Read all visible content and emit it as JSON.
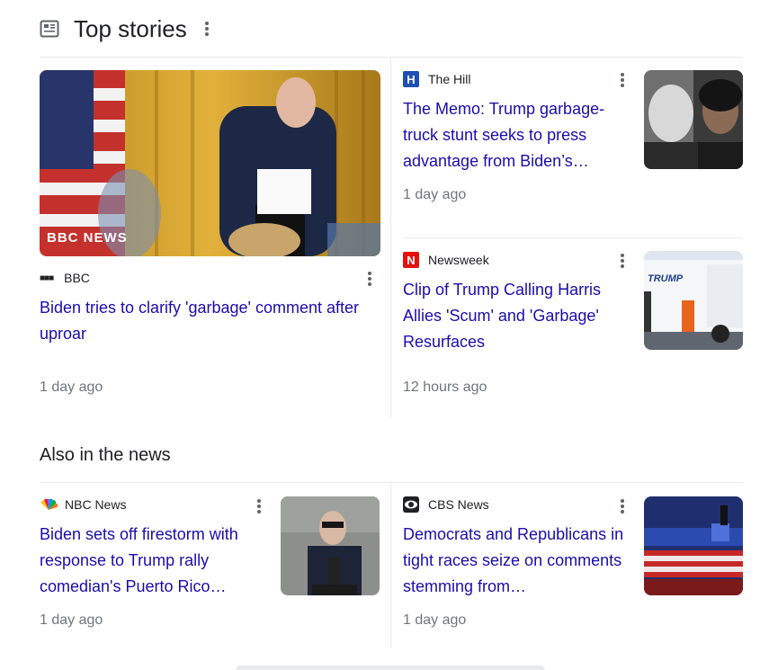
{
  "top_stories": {
    "title": "Top stories",
    "cards": [
      {
        "source": "BBC",
        "headline": "Biden tries to clarify 'garbage' comment after uproar",
        "time": "1 day ago",
        "image_label": "BBC NEWS"
      },
      {
        "source": "The Hill",
        "headline": "The Memo: Trump garbage-truck stunt seeks to press advantage from Biden’s…",
        "time": "1 day ago"
      },
      {
        "source": "Newsweek",
        "headline": "Clip of Trump Calling Harris Allies 'Scum' and 'Garbage' Resurfaces",
        "time": "12 hours ago",
        "image_label": "TRUMP"
      }
    ]
  },
  "also_in_news": {
    "title": "Also in the news",
    "cards": [
      {
        "source": "NBC News",
        "headline": "Biden sets off firestorm with response to Trump rally comedian's Puerto Rico…",
        "time": "1 day ago"
      },
      {
        "source": "CBS News",
        "headline": "Democrats and Republicans in tight races seize on comments stemming from…",
        "time": "1 day ago"
      }
    ]
  },
  "colors": {
    "link": "#1a0dab",
    "meta": "#70757a",
    "divider": "#e8eaed",
    "the_hill": "#1f4fb5",
    "newsweek": "#e3120b"
  },
  "icons": {
    "section": "newspaper-icon",
    "menu": "more-vert-icon"
  }
}
